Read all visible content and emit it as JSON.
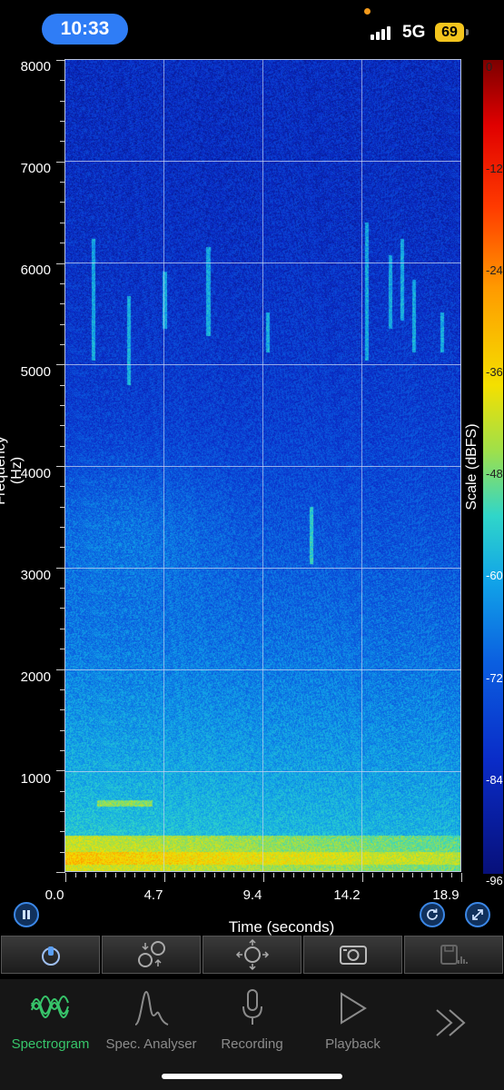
{
  "status_bar": {
    "time": "10:33",
    "network": "5G",
    "battery": "69"
  },
  "chart_data": {
    "type": "heatmap",
    "title": "",
    "xlabel": "Time (seconds)",
    "ylabel": "Frequency (Hz)",
    "x_ticks": [
      "0.0",
      "4.7",
      "9.4",
      "14.2",
      "18.9"
    ],
    "y_ticks": [
      "8000",
      "7000",
      "6000",
      "5000",
      "4000",
      "3000",
      "2000",
      "1000"
    ],
    "xlim": [
      0,
      19.5
    ],
    "ylim": [
      0,
      8000
    ],
    "colorbar": {
      "label": "Scale (dBFS)",
      "ticks": [
        "0",
        "-12",
        "-24",
        "-36",
        "-48",
        "-60",
        "-72",
        "-84",
        "-96"
      ],
      "range": [
        -96,
        0
      ]
    },
    "colormap": [
      "#07107a",
      "#0a2cc8",
      "#0b5fe0",
      "#11a4e8",
      "#30d6c9",
      "#9fe04a",
      "#f4e000",
      "#ff9a00",
      "#e00000"
    ],
    "grid": true
  },
  "controls": {
    "pause_icon": "pause-icon",
    "refresh_icon": "refresh-icon",
    "expand_icon": "expand-icon"
  },
  "toolbar": {
    "items": [
      "input-gain-icon",
      "zoom-pan-vertical-icon",
      "pan-icon",
      "snapshot-icon",
      "save-icon"
    ]
  },
  "tabs": [
    {
      "label": "Spectrogram",
      "icon": "waveform-icon",
      "active": true
    },
    {
      "label": "Spec. Analyser",
      "icon": "spectrum-peak-icon",
      "active": false
    },
    {
      "label": "Recording",
      "icon": "microphone-icon",
      "active": false
    },
    {
      "label": "Playback",
      "icon": "play-icon",
      "active": false
    },
    {
      "label": "",
      "icon": "more-icon",
      "active": false
    }
  ],
  "colors": {
    "accent_active": "#37c56a",
    "button_blue": "#3b87e6",
    "time_pill": "#2f7df6",
    "battery": "#f4c51d"
  }
}
